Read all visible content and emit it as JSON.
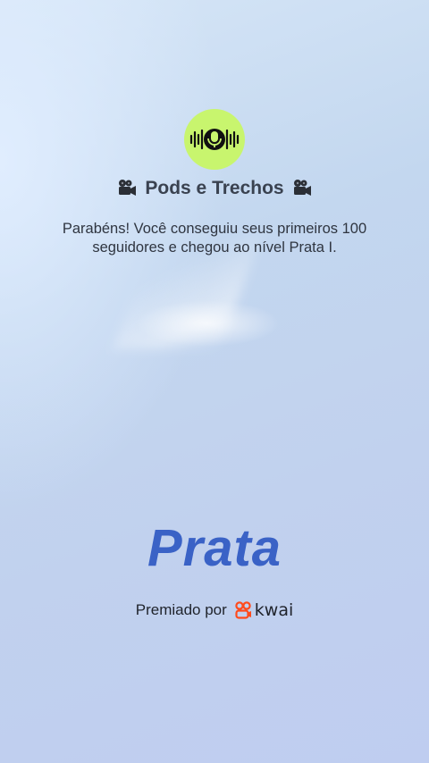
{
  "profile": {
    "name": "Pods e Trechos",
    "avatar_icon": "podcast-microphone-icon",
    "title_emoji_icon": "movie-camera-icon"
  },
  "message": {
    "text": "Parabéns! Você conseguiu seus primeiros 100 seguidores e chegou ao nível Prata I."
  },
  "level": {
    "label": "Prata"
  },
  "award": {
    "prefix": "Premiado por",
    "brand": "kwai",
    "brand_icon": "kwai-logo-icon"
  },
  "colors": {
    "avatar_bg": "#c8f56e",
    "level_text": "#3a62c6",
    "brand_logo": "#ff4a1c"
  }
}
